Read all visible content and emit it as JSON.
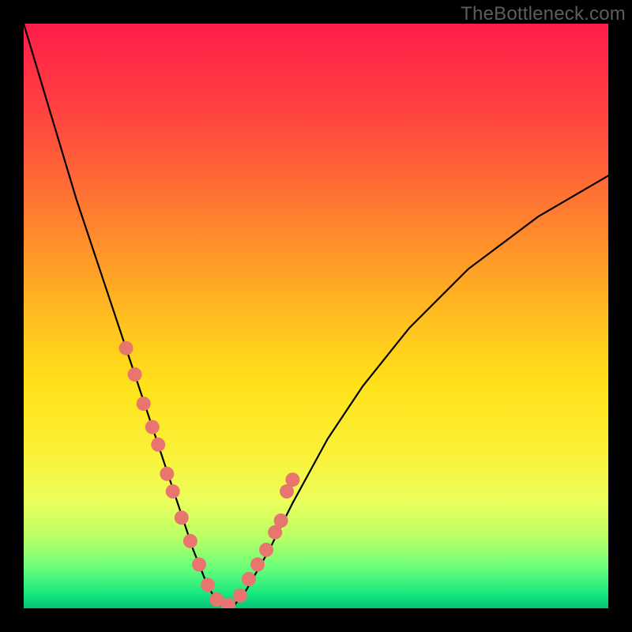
{
  "watermark": "TheBottleneck.com",
  "chart_data": {
    "type": "line",
    "title": "",
    "xlabel": "",
    "ylabel": "",
    "xlim": [
      0,
      100
    ],
    "ylim": [
      0,
      100
    ],
    "series": [
      {
        "name": "bottleneck-curve",
        "x": [
          0,
          3,
          6,
          9,
          12,
          15,
          17,
          19,
          21,
          23,
          25,
          27,
          29,
          31,
          32.5,
          34,
          36,
          38,
          42,
          46,
          52,
          58,
          66,
          76,
          88,
          100
        ],
        "y": [
          100,
          90,
          80,
          70,
          61,
          52,
          46,
          40,
          34,
          28,
          22,
          16,
          10,
          5,
          2,
          0.5,
          0.5,
          3,
          10,
          18,
          29,
          38,
          48,
          58,
          67,
          74
        ]
      }
    ],
    "markers": {
      "name": "highlight-dots",
      "color": "#e8766f",
      "radius_px": 9,
      "x": [
        17.5,
        19.0,
        20.5,
        22.0,
        23.0,
        24.5,
        25.5,
        27.0,
        28.5,
        30.0,
        31.5,
        33.0,
        35.0,
        37.0,
        38.5,
        40.0,
        41.5,
        43.0,
        44.0,
        45.0,
        46.0
      ],
      "y": [
        44.5,
        40.0,
        35.0,
        31.0,
        28.0,
        23.0,
        20.0,
        15.5,
        11.5,
        7.5,
        4.0,
        1.5,
        0.6,
        2.2,
        5.0,
        7.5,
        10.0,
        13.0,
        15.0,
        20.0,
        22.0
      ]
    },
    "gradient_stops": [
      {
        "pos": 0.0,
        "color": "#ff1d4a"
      },
      {
        "pos": 0.18,
        "color": "#ff4b3e"
      },
      {
        "pos": 0.36,
        "color": "#ff8a2c"
      },
      {
        "pos": 0.52,
        "color": "#ffc41e"
      },
      {
        "pos": 0.62,
        "color": "#ffe21a"
      },
      {
        "pos": 0.74,
        "color": "#faf23a"
      },
      {
        "pos": 0.82,
        "color": "#eaff5c"
      },
      {
        "pos": 0.88,
        "color": "#b7ff66"
      },
      {
        "pos": 0.93,
        "color": "#6bff7a"
      },
      {
        "pos": 0.975,
        "color": "#17e880"
      },
      {
        "pos": 1.0,
        "color": "#06c474"
      }
    ]
  }
}
